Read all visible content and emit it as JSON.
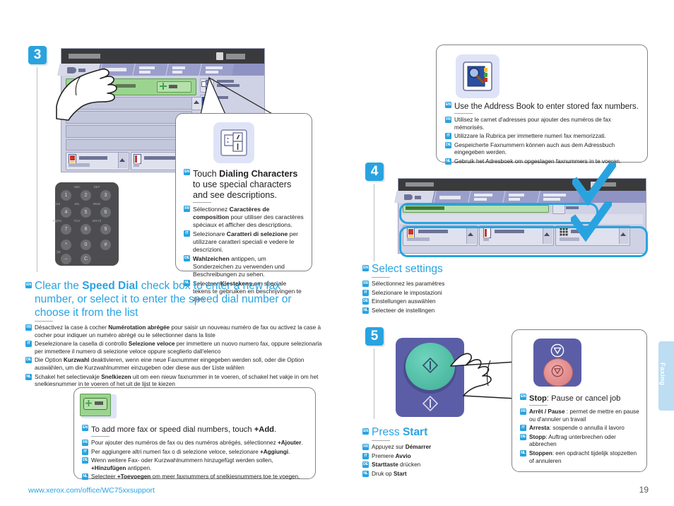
{
  "document": {
    "footer_url": "www.xerox.com/office/WC75xxsupport",
    "page_number": "19",
    "side_tab": "Faxing"
  },
  "steps": {
    "three": "3",
    "four": "4",
    "five": "5"
  },
  "dialing_characters_callout": {
    "icon": "dialing-characters-icon",
    "lines": [
      {
        "lang": "EN",
        "text_pre": "Touch ",
        "bold": "Dialing Characters",
        "text_post": " to use special characters and see descriptions."
      },
      {
        "lang": "FR",
        "text_pre": "Sélectionnez ",
        "bold": "Caractères de composition",
        "text_post": " pour utiliser des caractères spéciaux et afficher des descriptions."
      },
      {
        "lang": "IT",
        "text_pre": "Selezionare ",
        "bold": "Caratteri di selezione",
        "text_post": " per utilizzare caratteri speciali e vedere le descrizioni."
      },
      {
        "lang": "DE",
        "text_pre": "",
        "bold": "Wahlzeichen",
        "text_post": " antippen, um Sonderzeichen zu verwenden und Beschreibungen zu sehen."
      },
      {
        "lang": "NL",
        "text_pre": "Selecteer ",
        "bold": "Kiestekens",
        "text_post": " om speciale tekens te gebruiken en beschrijvingen te zien."
      }
    ]
  },
  "speed_dial_block": {
    "lines": [
      {
        "lang": "EN",
        "text_pre": "Clear the ",
        "bold": "Speed Dial",
        "text_post": " check box to enter a new fax number, or select it to enter the speed dial number or choose it from the list"
      },
      {
        "lang": "FR",
        "text_pre": "Désactivez la case à cocher ",
        "bold": "Numérotation abrégée",
        "text_post": " pour saisir un nouveau numéro de fax ou activez la case à cocher pour indiquer un numéro abrégé ou le sélectionner dans la liste"
      },
      {
        "lang": "IT",
        "text_pre": "Deselezionare la casella di controllo ",
        "bold": "Selezione veloce",
        "text_post": " per immettere un nuovo numero fax, oppure selezionarla per immettere il numero di selezione veloce oppure sceglierlo dall'elenco"
      },
      {
        "lang": "DE",
        "text_pre": "Die Option ",
        "bold": "Kurzwahl",
        "text_post": " deaktivieren, wenn eine neue Faxnummer eingegeben werden soll, oder die Option auswählen, um die Kurzwahlnummer einzugeben oder diese aus der Liste wählen"
      },
      {
        "lang": "NL",
        "text_pre": "Schakel het selectievakje ",
        "bold": "Snelkiezen",
        "text_post": " uit om een nieuw faxnummer in te voeren, of schakel het vakje in om het snelkiesnummer in te voeren of het uit de lijst te kiezen"
      }
    ]
  },
  "add_callout": {
    "icon": "add-button-icon",
    "lines": [
      {
        "lang": "EN",
        "text_pre": "To add more fax or speed dial  numbers, touch ",
        "bold": "+Add",
        "text_post": "."
      },
      {
        "lang": "FR",
        "text_pre": "Pour ajouter des numéros de fax ou des numéros abrégés, sélectionnez ",
        "bold": "+Ajouter",
        "text_post": "."
      },
      {
        "lang": "IT",
        "text_pre": "Per aggiungere altri numeri fax o di selezione veloce, selezionare ",
        "bold": "+Aggiungi",
        "text_post": "."
      },
      {
        "lang": "DE",
        "text_pre": "Wenn weitere Fax- oder Kurzwahlnummern hinzugefügt werden sollen, ",
        "bold": "+Hinzufügen",
        "text_post": " antippen."
      },
      {
        "lang": "NL",
        "text_pre": "Selecteer ",
        "bold": "+Toevoegen",
        "text_post": " om meer faxnummers of snelkiesnummers toe te voegen."
      }
    ]
  },
  "address_book_callout": {
    "icon": "address-book-icon",
    "lines": [
      {
        "lang": "EN",
        "text_pre": "Use the Address Book to enter stored fax numbers.",
        "bold": "",
        "text_post": ""
      },
      {
        "lang": "FR",
        "text_pre": "Utilisez le carnet d'adresses pour ajouter des numéros de fax mémorisés.",
        "bold": "",
        "text_post": ""
      },
      {
        "lang": "IT",
        "text_pre": "Utilizzare la Rubrica per immettere numeri fax memorizzati.",
        "bold": "",
        "text_post": ""
      },
      {
        "lang": "DE",
        "text_pre": "Gespeicherte Faxnummern können auch aus dem Adressbuch eingegeben werden.",
        "bold": "",
        "text_post": ""
      },
      {
        "lang": "NL",
        "text_pre": "Gebruik het Adresboek om opgeslagen faxnummers in te voeren.",
        "bold": "",
        "text_post": ""
      }
    ]
  },
  "select_settings_block": {
    "lines": [
      {
        "lang": "EN",
        "text_pre": "Select settings",
        "bold": "",
        "text_post": ""
      },
      {
        "lang": "FR",
        "text_pre": "Sélectionnez les paramètres",
        "bold": "",
        "text_post": ""
      },
      {
        "lang": "IT",
        "text_pre": "Selezionare le impostazioni",
        "bold": "",
        "text_post": ""
      },
      {
        "lang": "DE",
        "text_pre": "Einstellungen auswählen",
        "bold": "",
        "text_post": ""
      },
      {
        "lang": "NL",
        "text_pre": "Selecteer de instellingen",
        "bold": "",
        "text_post": ""
      }
    ]
  },
  "press_start_block": {
    "lines": [
      {
        "lang": "EN",
        "text_pre": "Press ",
        "bold": "Start",
        "text_post": ""
      },
      {
        "lang": "FR",
        "text_pre": "Appuyez sur ",
        "bold": "Démarrer",
        "text_post": ""
      },
      {
        "lang": "IT",
        "text_pre": "Premere ",
        "bold": "Avvio",
        "text_post": ""
      },
      {
        "lang": "DE",
        "text_pre": "",
        "bold": "Starttaste",
        "text_post": " drücken"
      },
      {
        "lang": "NL",
        "text_pre": "Druk op ",
        "bold": "Start",
        "text_post": ""
      }
    ]
  },
  "stop_callout": {
    "icon": "stop-button-icon",
    "lines": [
      {
        "lang": "EN",
        "text_pre": "",
        "bold": "Stop",
        "text_post": ": Pause or cancel job"
      },
      {
        "lang": "FR",
        "text_pre": "",
        "bold": "Arrêt / Pause",
        "text_post": " : permet de mettre en pause ou d'annuler un travail"
      },
      {
        "lang": "IT",
        "text_pre": "",
        "bold": "Arresta",
        "text_post": ": sospende o annulla il lavoro"
      },
      {
        "lang": "DE",
        "text_pre": "",
        "bold": "Stopp",
        "text_post": ": Auftrag unterbrechen oder abbrechen"
      },
      {
        "lang": "NL",
        "text_pre": "",
        "bold": "Stoppen",
        "text_post": ": een opdracht tijdelijk stopzetten of annuleren"
      }
    ]
  },
  "keypad": {
    "keys": [
      "1",
      "2",
      "3",
      "4",
      "5",
      "6",
      "7",
      "8",
      "9",
      "*",
      "0",
      "#"
    ],
    "letters": [
      "",
      "ABC",
      "DEF",
      "GHI",
      "JKL",
      "MNO",
      "PQRS",
      "TUV",
      "WXYZ",
      "",
      "",
      ""
    ],
    "extra_keys": [
      "–",
      "C"
    ]
  },
  "colors": {
    "accent": "#29a3e0",
    "green_button": "#9bd48f",
    "start_button": "#4cbfa6",
    "stop_button": "#e08a8a",
    "control_panel": "#5b5ea6"
  }
}
